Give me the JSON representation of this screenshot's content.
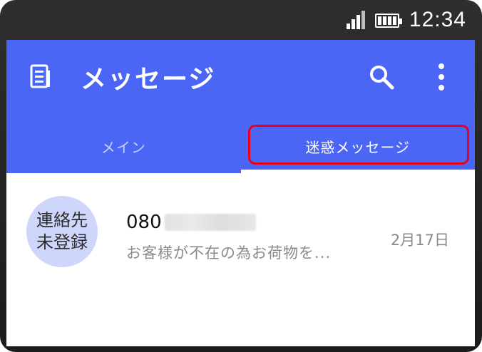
{
  "status_bar": {
    "time": "12:34",
    "signal_icon": "signal-icon",
    "battery_icon": "battery-icon"
  },
  "app_bar": {
    "title": "メッセージ",
    "icons": [
      "messages-app-icon",
      "search-icon",
      "more-options-icon"
    ],
    "color": "#4b66f4"
  },
  "tabs": [
    {
      "label": "メイン",
      "selected": false
    },
    {
      "label": "迷惑メッセージ",
      "selected": true,
      "highlight_color": "#e8001c"
    }
  ],
  "messages": [
    {
      "avatar_line1": "連絡先",
      "avatar_line2": "未登録",
      "sender_visible": "080",
      "preview": "お客様が不在の為お荷物を...",
      "date": "2月17日"
    }
  ]
}
